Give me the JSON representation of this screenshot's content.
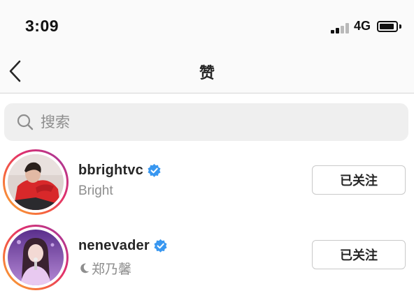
{
  "status_bar": {
    "time": "3:09",
    "network": "4G",
    "signal_icon": "cellular-signal-icon",
    "battery_icon": "battery-icon"
  },
  "header": {
    "title": "赞",
    "back_icon": "chevron-left-icon"
  },
  "search": {
    "placeholder": "搜索",
    "value": "",
    "icon": "search-icon"
  },
  "users": [
    {
      "username": "bbrightvc",
      "full_name": "Bright",
      "verified": true,
      "status_icon": null,
      "follow_label": "已关注"
    },
    {
      "username": "nenevader",
      "full_name": "郑乃馨",
      "verified": true,
      "status_icon": "moon-icon",
      "follow_label": "已关注"
    }
  ],
  "colors": {
    "verified": "#3897f0",
    "secondary_text": "#8e8e8e",
    "primary_text": "#262626",
    "story_ring_start": "#f9b233",
    "story_ring_end": "#833ab4"
  }
}
